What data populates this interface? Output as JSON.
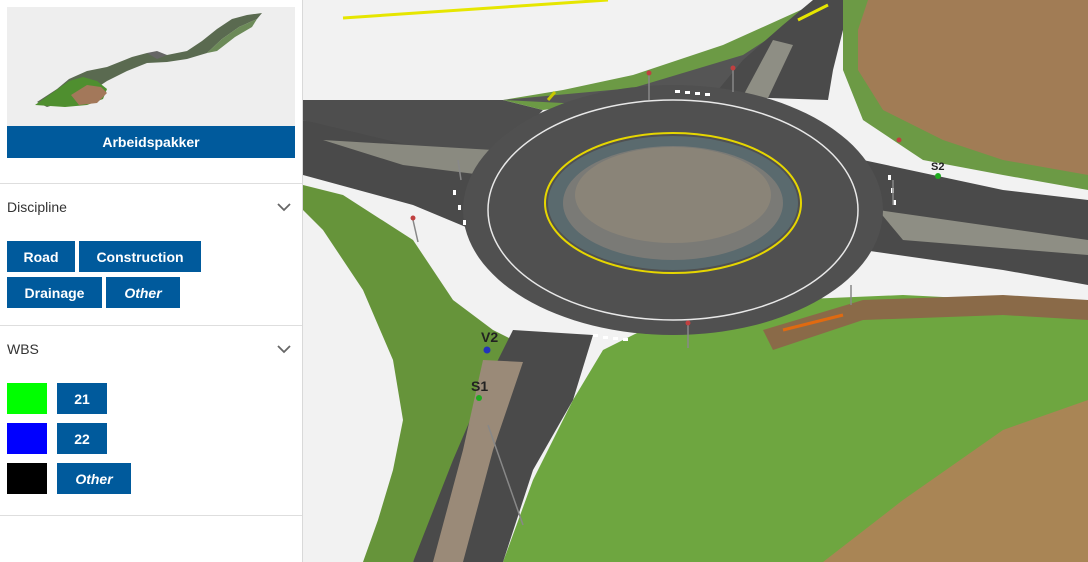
{
  "sidebar": {
    "package_button": "Arbeidspakker",
    "discipline": {
      "title": "Discipline",
      "tags": [
        "Road",
        "Construction",
        "Drainage",
        "Other"
      ]
    },
    "wbs": {
      "title": "WBS",
      "items": [
        {
          "label": "21",
          "color": "#00ff00"
        },
        {
          "label": "22",
          "color": "#0000ff"
        },
        {
          "label": "Other",
          "color": "#000000"
        }
      ]
    }
  },
  "viewport": {
    "markers": {
      "v2": "V2",
      "s1": "S1",
      "s2": "S2"
    }
  },
  "colors": {
    "accent": "#005a9c",
    "grass": "#6a9a3a",
    "asphalt": "#4a4a4a",
    "soil": "#9a7650"
  },
  "icons": {
    "collapse": "chevron-down-icon"
  }
}
